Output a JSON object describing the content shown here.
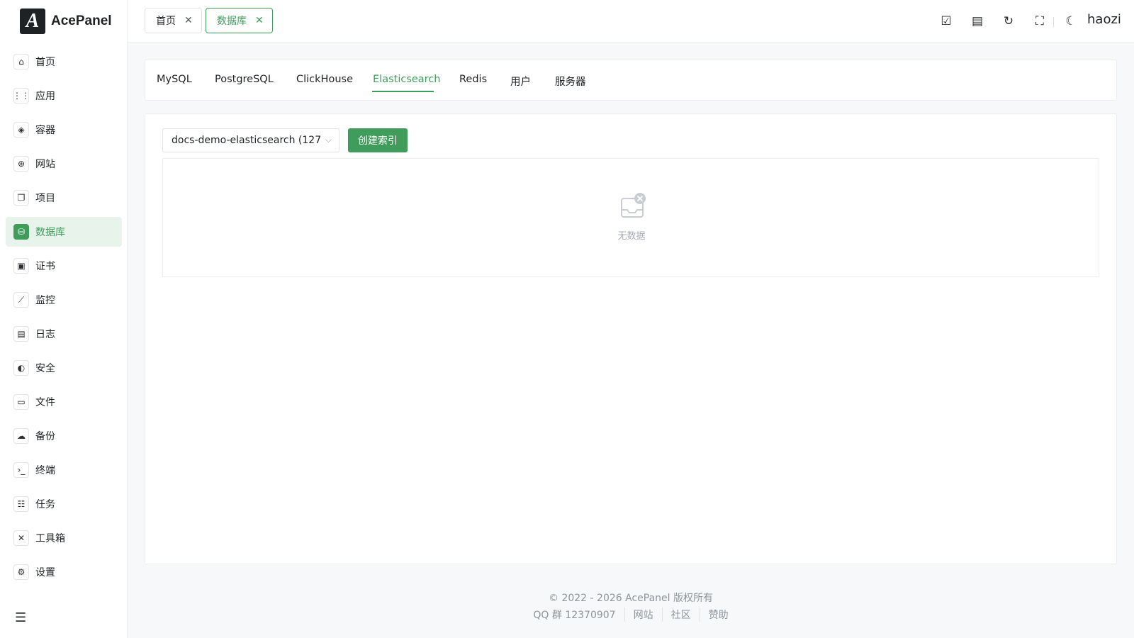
{
  "brand": {
    "logo_letter": "A",
    "name": "AcePanel"
  },
  "sidebar": {
    "items": [
      {
        "label": "首页",
        "icon": "⌂",
        "icon_name": "home-icon"
      },
      {
        "label": "应用",
        "icon": "⋮⋮",
        "icon_name": "apps-icon"
      },
      {
        "label": "容器",
        "icon": "◈",
        "icon_name": "container-icon"
      },
      {
        "label": "网站",
        "icon": "⊕",
        "icon_name": "globe-icon"
      },
      {
        "label": "项目",
        "icon": "❐",
        "icon_name": "project-icon"
      },
      {
        "label": "数据库",
        "icon": "⛁",
        "icon_name": "database-icon",
        "active": true
      },
      {
        "label": "证书",
        "icon": "▣",
        "icon_name": "certificate-icon"
      },
      {
        "label": "监控",
        "icon": "⟋",
        "icon_name": "monitor-chart-icon"
      },
      {
        "label": "日志",
        "icon": "▤",
        "icon_name": "log-file-icon"
      },
      {
        "label": "安全",
        "icon": "◐",
        "icon_name": "shield-icon"
      },
      {
        "label": "文件",
        "icon": "▭",
        "icon_name": "folder-icon"
      },
      {
        "label": "备份",
        "icon": "☁",
        "icon_name": "cloud-backup-icon"
      },
      {
        "label": "终端",
        "icon": "›_",
        "icon_name": "terminal-icon"
      },
      {
        "label": "任务",
        "icon": "☷",
        "icon_name": "task-icon"
      },
      {
        "label": "工具箱",
        "icon": "✕",
        "icon_name": "toolbox-icon"
      },
      {
        "label": "设置",
        "icon": "⚙",
        "icon_name": "settings-icon"
      }
    ],
    "collapse_icon": "☰"
  },
  "header": {
    "tabs": [
      {
        "label": "首页",
        "close": "✕"
      },
      {
        "label": "数据库",
        "close": "✕",
        "active": true
      }
    ],
    "icons": {
      "tasks": "☑",
      "doc": "▤",
      "refresh": "↻",
      "fullscreen": "⛶",
      "theme": "☾"
    },
    "user": "haozi"
  },
  "db_tabs": [
    "MySQL",
    "PostgreSQL",
    "ClickHouse",
    "Elasticsearch",
    "Redis",
    "用户",
    "服务器"
  ],
  "db_tab_active": "Elasticsearch",
  "main": {
    "select_value": "docs-demo-elasticsearch (127....",
    "select_arrow": "⌵",
    "create_button": "创建索引",
    "empty_text": "无数据"
  },
  "footer": {
    "copyright": "© 2022 - 2026 AcePanel 版权所有",
    "qq": "QQ 群 12370907",
    "links": [
      "网站",
      "社区",
      "赞助"
    ]
  },
  "colors": {
    "accent": "#3f9c5b",
    "accent_light": "#e8f3ec"
  }
}
